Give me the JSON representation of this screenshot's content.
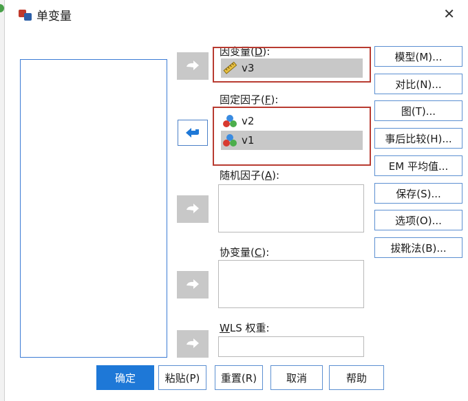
{
  "dialog": {
    "title": "单变量",
    "close_label": "✕"
  },
  "dependent": {
    "label_pre": "因变量(",
    "label_key": "D",
    "label_post": "):",
    "value": "v3"
  },
  "fixed_factors": {
    "label_pre": "固定因子(",
    "label_key": "F",
    "label_post": "):",
    "items": [
      "v2",
      "v1"
    ]
  },
  "random_factors": {
    "label_pre": "随机因子(",
    "label_key": "A",
    "label_post": "):"
  },
  "covariates": {
    "label_pre": "协变量(",
    "label_key": "C",
    "label_post": "):"
  },
  "wls": {
    "label_pre": "",
    "label_key": "W",
    "label_post": "LS 权重:"
  },
  "side_buttons": [
    "模型(M)...",
    "对比(N)...",
    "图(T)...",
    "事后比较(H)...",
    "EM 平均值...",
    "保存(S)...",
    "选项(O)...",
    "拔靴法(B)..."
  ],
  "bottom_buttons": {
    "ok": "确定",
    "paste": "粘贴(P)",
    "reset": "重置(R)",
    "cancel": "取消",
    "help": "帮助"
  },
  "colors": {
    "primary": "#1e78d7",
    "highlight_border": "#b83a30",
    "button_border": "#5b8fd1",
    "selected_bg": "#c8c8c8"
  },
  "icons": {
    "scale": "ruler-scale-icon",
    "nominal": "three-balls-nominal-icon",
    "arrow_right": "arrow-right-icon",
    "arrow_left": "arrow-left-icon"
  }
}
